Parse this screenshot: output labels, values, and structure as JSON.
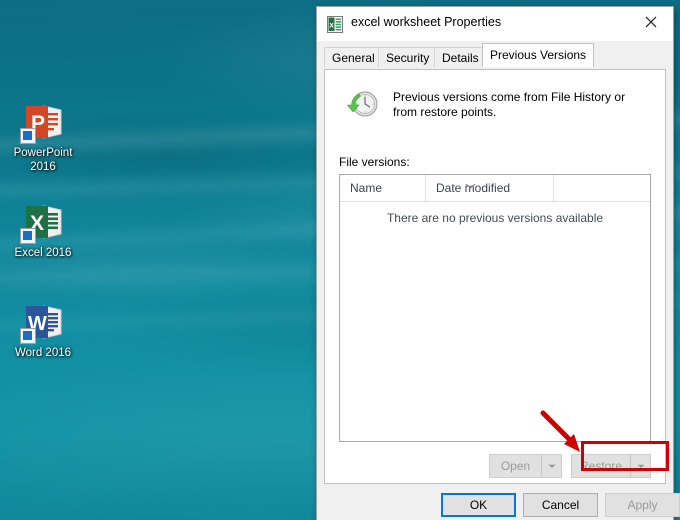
{
  "desktop": {
    "icons": [
      {
        "name": "powerpoint-2016",
        "label": "PowerPoint\n2016",
        "label_line1": "PowerPoint",
        "label_line2": "2016",
        "color": "#d24726",
        "letter": "P",
        "icon": "powerpoint-icon"
      },
      {
        "name": "excel-2016",
        "label": "Excel 2016",
        "label_line1": "Excel 2016",
        "label_line2": "",
        "color": "#1e7145",
        "letter": "X",
        "icon": "excel-icon"
      },
      {
        "name": "word-2016",
        "label": "Word 2016",
        "label_line1": "Word 2016",
        "label_line2": "",
        "color": "#2b579a",
        "letter": "W",
        "icon": "word-icon"
      }
    ],
    "background_color": "#0f8599"
  },
  "dialog": {
    "title": "excel worksheet Properties",
    "title_icon": "excel-document-icon",
    "close_label": "Close",
    "close_icon": "close-icon",
    "tabs": [
      {
        "label": "General",
        "active": false
      },
      {
        "label": "Security",
        "active": false
      },
      {
        "label": "Details",
        "active": false
      },
      {
        "label": "Previous Versions",
        "active": true
      }
    ],
    "info": {
      "icon": "restore-clock-icon",
      "text": "Previous versions come from File History or from restore points."
    },
    "file_versions_label": "File versions:",
    "list": {
      "columns": [
        {
          "label": "Name",
          "sorted": false
        },
        {
          "label": "Date modified",
          "sorted": true,
          "sort_icon": "chevron-down-icon"
        },
        {
          "label": "",
          "sorted": false
        }
      ],
      "rows": [],
      "empty_message": "There are no previous versions available"
    },
    "actions": {
      "open": {
        "label": "Open",
        "enabled": false,
        "dropdown_icon": "chevron-down-icon"
      },
      "restore": {
        "label": "Restore",
        "enabled": false,
        "dropdown_icon": "chevron-down-icon",
        "highlighted": true
      }
    },
    "footer": {
      "ok": {
        "label": "OK",
        "enabled": true,
        "default": true
      },
      "cancel": {
        "label": "Cancel",
        "enabled": true,
        "default": false
      },
      "apply": {
        "label": "Apply",
        "enabled": false,
        "default": false
      }
    }
  },
  "annotation": {
    "highlight_color": "#cc0000",
    "arrow_icon": "red-arrow-pointer",
    "target": "Restore"
  }
}
